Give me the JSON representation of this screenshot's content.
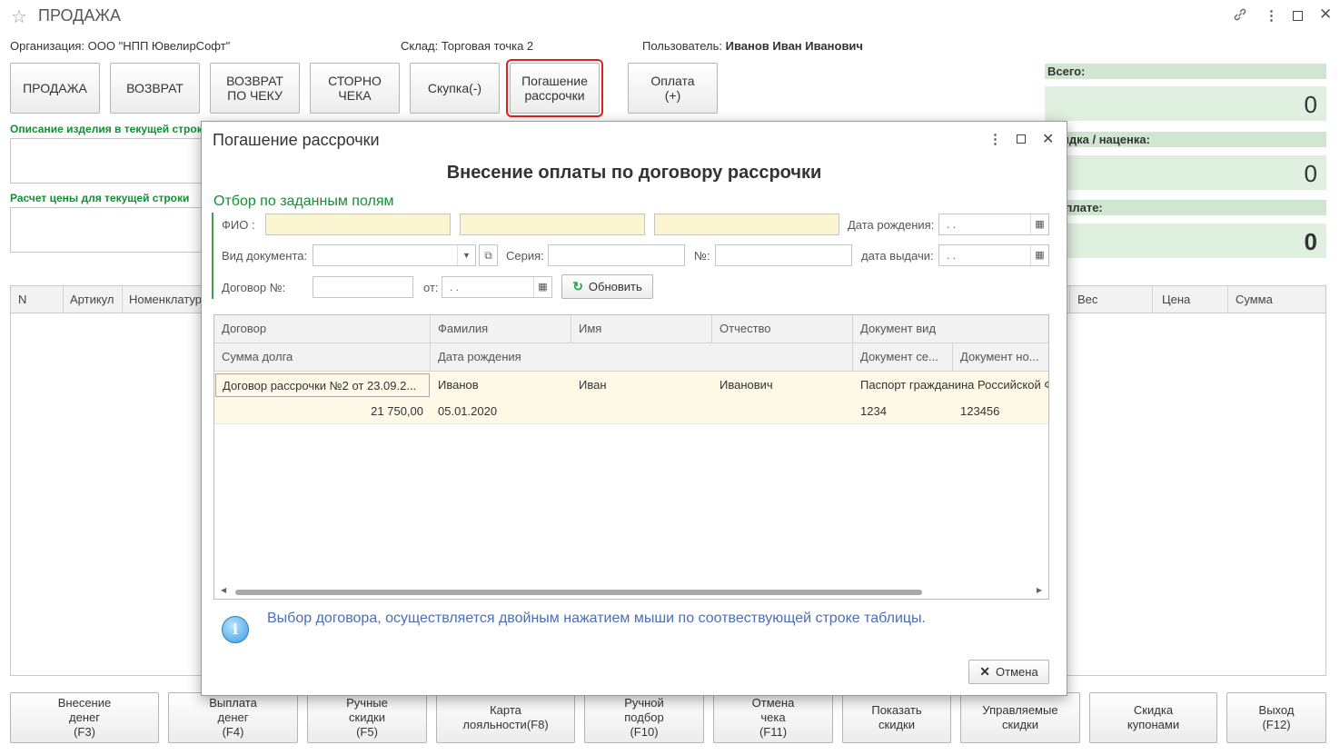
{
  "window": {
    "title": "ПРОДАЖА",
    "controls": [
      "link-icon",
      "more-icon",
      "maximize-icon",
      "close-icon"
    ]
  },
  "info": {
    "org_label": "Организация:",
    "org_value": "ООО \"НПП ЮвелирСофт\"",
    "store_label": "Склад:",
    "store_value": "Торговая точка 2",
    "user_label": "Пользователь:",
    "user_value": "Иванов Иван Иванович"
  },
  "mode_buttons": [
    {
      "label": "ПРОДАЖА"
    },
    {
      "label": "ВОЗВРАТ"
    },
    {
      "label": "ВОЗВРАТ\nПО ЧЕКУ"
    },
    {
      "label": "СТОРНО\nЧЕКА"
    },
    {
      "label": "Скупка(-)"
    },
    {
      "label": "Погашение\nрассрочки"
    },
    {
      "label": "Оплата\n(+)"
    }
  ],
  "left_panel": {
    "description_label": "Описание изделия в текущей строке",
    "price_calc_label": "Расчет цены для текущей строки"
  },
  "totals": {
    "total_label": "Всего:",
    "total_value": "0",
    "discount_label": "Скидка / наценка:",
    "discount_value": "0",
    "to_pay_label": "К оплате:",
    "to_pay_value": "0"
  },
  "main_table": {
    "columns": [
      "N",
      "Артикул",
      "Номенклатура",
      "Вес",
      "Цена",
      "Сумма"
    ]
  },
  "bottom_buttons": [
    {
      "label": "Внесение\nденег\n(F3)"
    },
    {
      "label": "Выплата\nденег\n(F4)"
    },
    {
      "label": "Ручные\nскидки\n(F5)"
    },
    {
      "label": "Карта\nлояльности(F8)"
    },
    {
      "label": "Ручной\nподбор\n(F10)"
    },
    {
      "label": "Отмена\nчека\n(F11)"
    },
    {
      "label": "Показать\nскидки"
    },
    {
      "label": "Управляемые\nскидки"
    },
    {
      "label": "Скидка\nкупонами"
    },
    {
      "label": "Выход\n(F12)"
    }
  ],
  "dialog": {
    "title": "Погашение рассрочки",
    "heading": "Внесение оплаты по договору рассрочки",
    "filter_title": "Отбор по заданным полям",
    "fio_label": "ФИО :",
    "birth_label": "Дата рождения:",
    "birth_value": " .  .",
    "doc_type_label": "Вид документа:",
    "series_label": "Серия:",
    "number_label": "№:",
    "issue_label": "дата выдачи:",
    "issue_value": " .  .",
    "contract_label": "Договор №:",
    "from_label": "от:",
    "from_value": " .  .",
    "refresh_label": "Обновить",
    "grid_headers_row1": [
      "Договор",
      "Фамилия",
      "Имя",
      "Отчество",
      "Документ вид"
    ],
    "grid_headers_row2": [
      "Сумма долга",
      "Дата рождения",
      "Документ се...",
      "Документ но..."
    ],
    "rows": [
      {
        "contract": "Договор рассрочки №2 от 23.09.2...",
        "last_name": "Иванов",
        "first_name": "Иван",
        "patronymic": "Иванович",
        "doc_type": "Паспорт гражданина Российской Ф",
        "debt": "21 750,00",
        "birth_date": "05.01.2020",
        "doc_series": "1234",
        "doc_number": "123456"
      }
    ],
    "hint": "Выбор договора, осуществляется двойным нажатием мыши по соотвествующей строке таблицы.",
    "cancel_label": "Отмена"
  }
}
